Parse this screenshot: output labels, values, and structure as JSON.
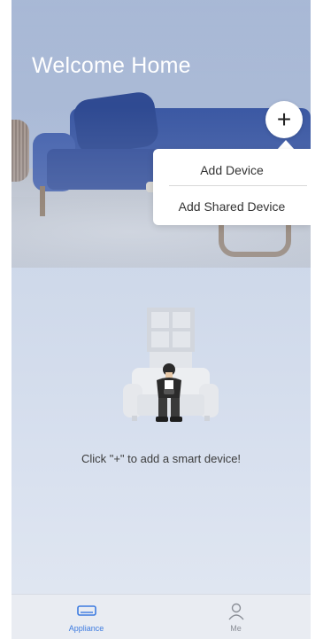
{
  "header": {
    "title": "Welcome Home",
    "add_button_icon": "plus-icon"
  },
  "add_menu": {
    "items": [
      {
        "label": "Add Device"
      },
      {
        "label": "Add Shared Device"
      }
    ]
  },
  "empty_state": {
    "illustration": "person-on-sofa-illustration",
    "message": "Click \"+\" to add a smart device!"
  },
  "tabbar": {
    "tabs": [
      {
        "label": "Appliance",
        "icon": "appliance-icon",
        "active": true,
        "color": "#3d7be0"
      },
      {
        "label": "Me",
        "icon": "person-icon",
        "active": false,
        "color": "#8a8e96"
      }
    ]
  }
}
